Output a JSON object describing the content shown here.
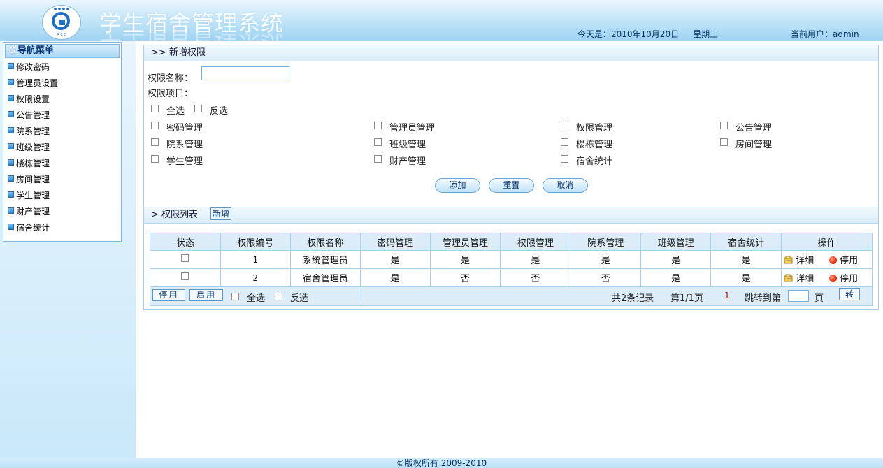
{
  "header": {
    "title": "学生宿舍管理系统",
    "date_label": "今天是：2010年10月20日",
    "weekday": "星期三",
    "user_label": "当前用户：admin"
  },
  "nav": {
    "title": "导航菜单",
    "items": [
      "修改密码",
      "管理员设置",
      "权限设置",
      "公告管理",
      "院系管理",
      "班级管理",
      "楼栋管理",
      "房间管理",
      "学生管理",
      "财产管理",
      "宿舍统计"
    ]
  },
  "add_section": {
    "title": ">> 新增权限",
    "name_label": "权限名称：",
    "name_value": "",
    "items_label": "权限项目：",
    "select_all": "全选",
    "invert": "反选",
    "items": [
      "密码管理",
      "管理员管理",
      "权限管理",
      "公告管理",
      "院系管理",
      "班级管理",
      "楼栋管理",
      "房间管理",
      "学生管理",
      "财产管理",
      "宿舍统计"
    ],
    "buttons": {
      "add": "添加",
      "reset": "重置",
      "cancel": "取消"
    }
  },
  "list_section": {
    "title": "> 权限列表",
    "new_button": "新增",
    "columns": [
      "状态",
      "权限编号",
      "权限名称",
      "密码管理",
      "管理员管理",
      "权限管理",
      "院系管理",
      "班级管理",
      "宿舍统计",
      "操作"
    ],
    "rows": [
      {
        "id": "1",
        "name": "系统管理员",
        "vals": [
          "是",
          "是",
          "是",
          "是",
          "是",
          "是"
        ],
        "detail": "详细",
        "stop": "停用"
      },
      {
        "id": "2",
        "name": "宿舍管理员",
        "vals": [
          "是",
          "否",
          "否",
          "否",
          "是",
          "是"
        ],
        "detail": "详细",
        "stop": "停用"
      }
    ],
    "footer": {
      "disable_btn": "停用",
      "enable_btn": "启用",
      "select_all": "全选",
      "invert": "反选",
      "total": "共2条记录",
      "page_info": "第1/1页",
      "page_num": "1",
      "jump_label": "跳转到第",
      "page_unit": "页",
      "go_btn": "转",
      "jump_value": ""
    }
  },
  "footer": {
    "copyright": "©版权所有 2009-2010"
  }
}
